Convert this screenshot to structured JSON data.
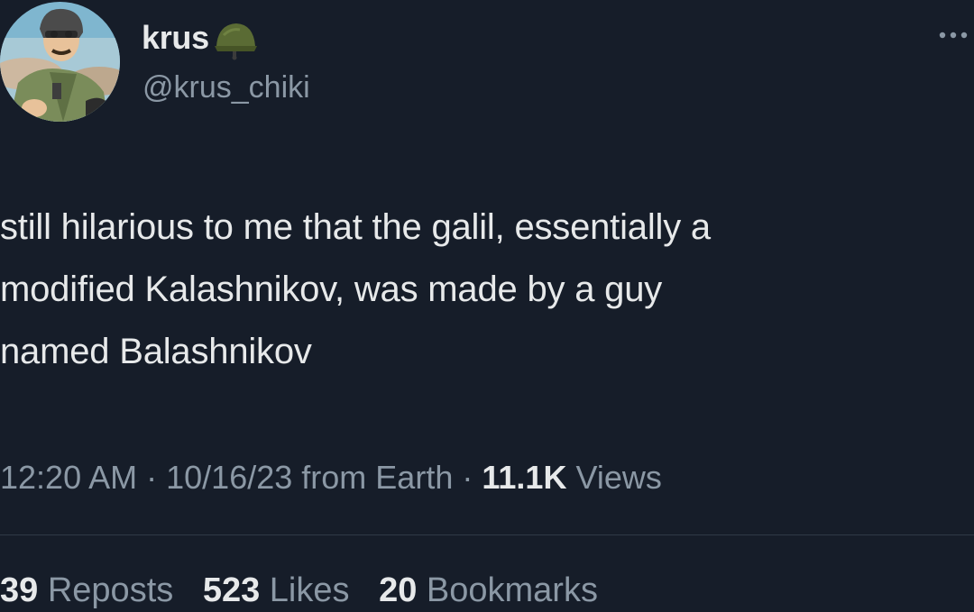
{
  "author": {
    "display_name": "krus",
    "handle": "@krus_chiki",
    "badge_icon": "army-helmet-icon",
    "avatar_icon": "cartoon-pilot-avatar"
  },
  "tweet": {
    "text_lines": [
      "still hilarious to me that the galil, essentially a",
      "modified Kalashnikov, was made by a guy",
      "named Balashnikov"
    ]
  },
  "meta": {
    "time": "12:20 AM",
    "separator": "·",
    "date": "10/16/23",
    "source": "from Earth",
    "views_count": "11.1K",
    "views_label": "Views"
  },
  "stats": {
    "reposts_count": "39",
    "reposts_label": "Reposts",
    "likes_count": "523",
    "likes_label": "Likes",
    "bookmarks_count": "20",
    "bookmarks_label": "Bookmarks"
  },
  "colors": {
    "background": "#161d29",
    "primary_text": "#e7e9ea",
    "secondary_text": "#8b98a5"
  },
  "more_icon": "more-options-icon"
}
